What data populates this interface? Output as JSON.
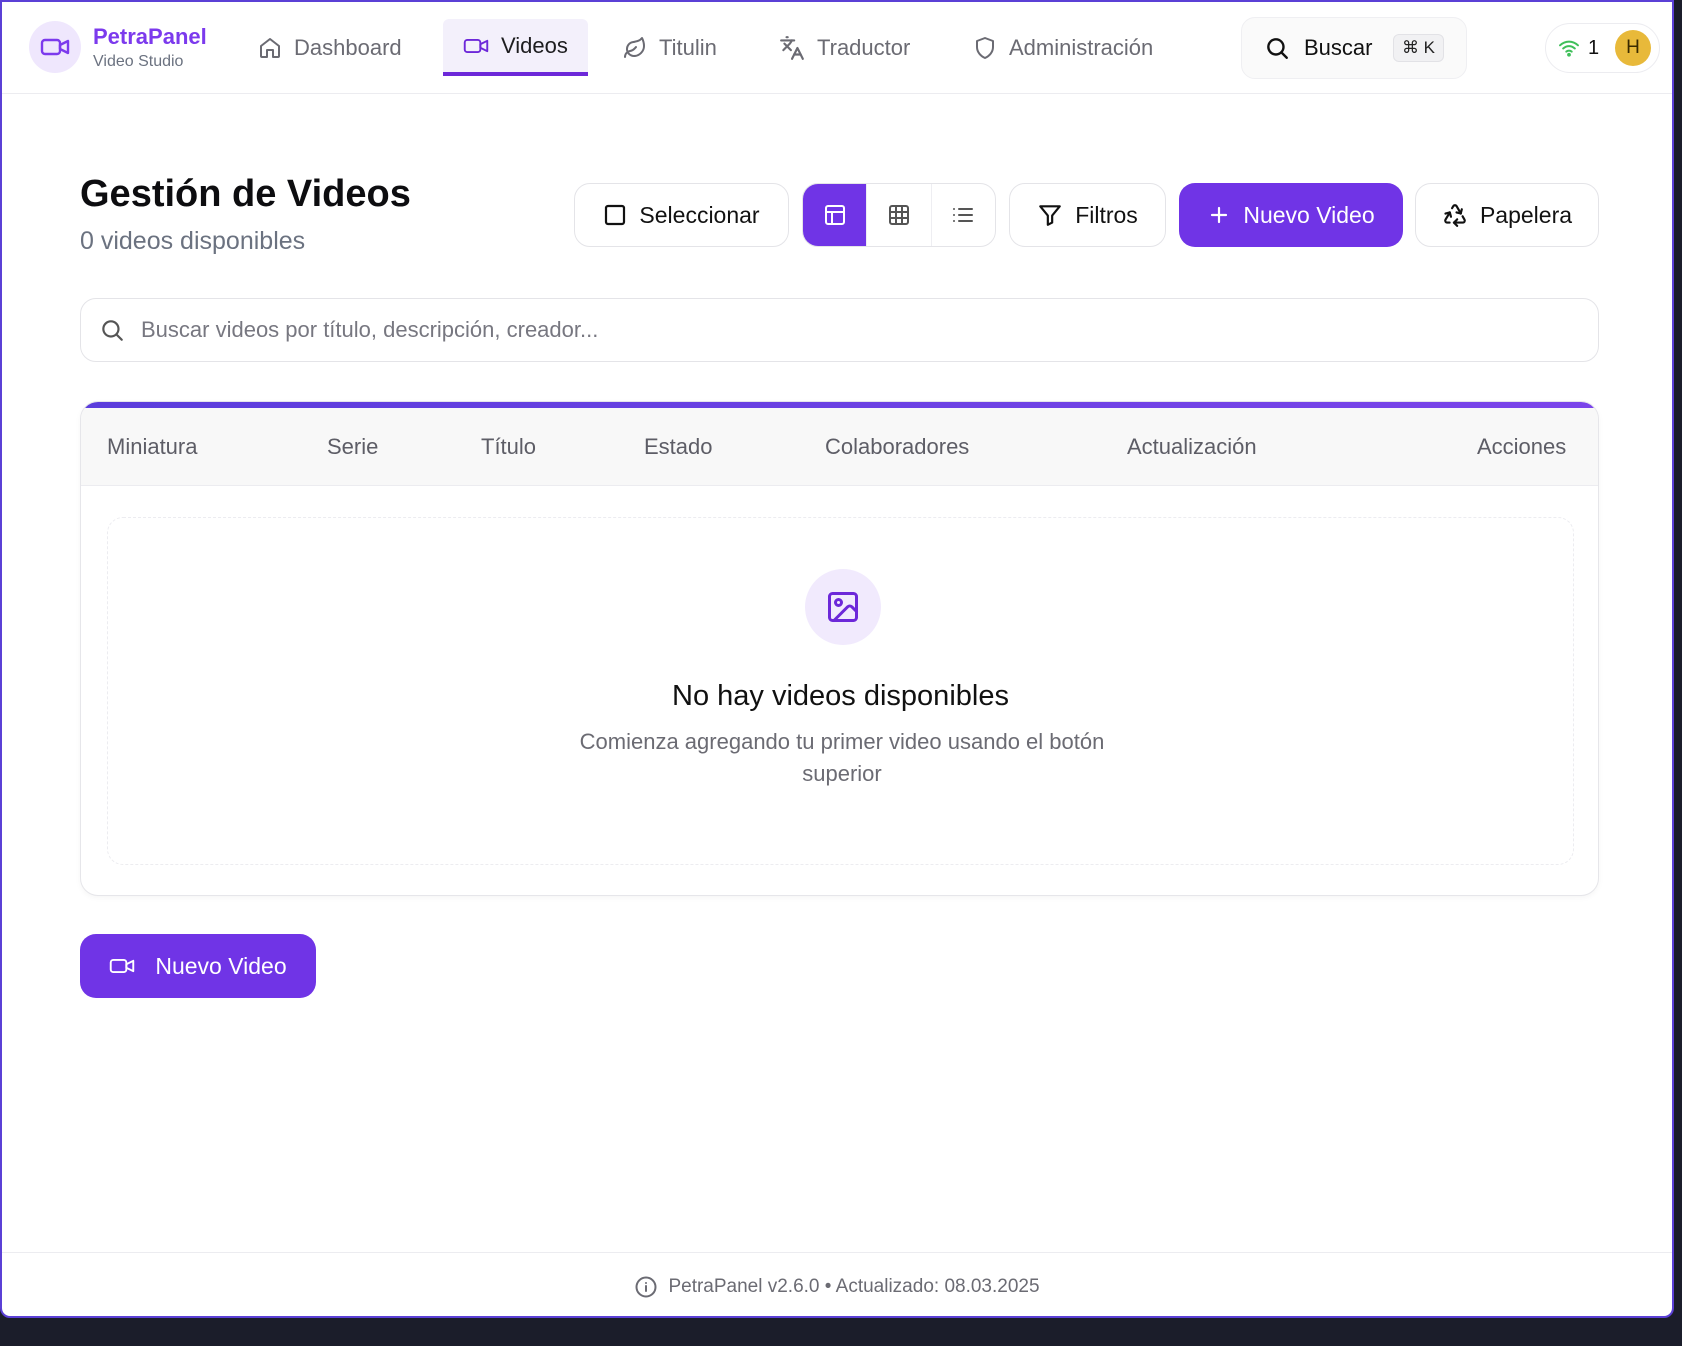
{
  "brand": {
    "name": "PetraPanel",
    "subtitle": "Video Studio"
  },
  "nav": {
    "items": [
      {
        "label": "Dashboard",
        "icon": "home-icon",
        "active": false
      },
      {
        "label": "Videos",
        "icon": "video-icon",
        "active": true
      },
      {
        "label": "Titulin",
        "icon": "leaf-icon",
        "active": false
      },
      {
        "label": "Traductor",
        "icon": "translate-icon",
        "active": false
      },
      {
        "label": "Administración",
        "icon": "shield-icon",
        "active": false
      }
    ]
  },
  "search": {
    "label": "Buscar",
    "shortcut": "⌘ K"
  },
  "user": {
    "notifications": "1",
    "initial": "H",
    "avatar_color": "#e8b93a"
  },
  "header": {
    "title": "Gestión de Videos",
    "subtitle": "0 videos disponibles",
    "select_label": "Seleccionar",
    "filters_label": "Filtros",
    "new_video_label": "Nuevo Video",
    "trash_label": "Papelera",
    "view_modes": [
      "table",
      "grid",
      "list"
    ],
    "active_view": "table"
  },
  "video_search": {
    "placeholder": "Buscar videos por título, descripción, creador...",
    "value": ""
  },
  "table": {
    "columns": [
      "Miniatura",
      "Serie",
      "Título",
      "Estado",
      "Colaboradores",
      "Actualización",
      "Acciones"
    ],
    "rows": []
  },
  "empty_state": {
    "title": "No hay videos disponibles",
    "description": "Comienza agregando tu primer video usando el botón superior",
    "icon": "image-icon"
  },
  "floating_button": {
    "label": "Nuevo Video",
    "icon": "video-icon"
  },
  "footer": {
    "text": "PetraPanel v2.6.0 • Actualizado: 08.03.2025",
    "icon": "info-icon"
  },
  "colors": {
    "accent": "#7034e6",
    "brand_text": "#7c3aed",
    "window_border": "#5b40d6"
  }
}
